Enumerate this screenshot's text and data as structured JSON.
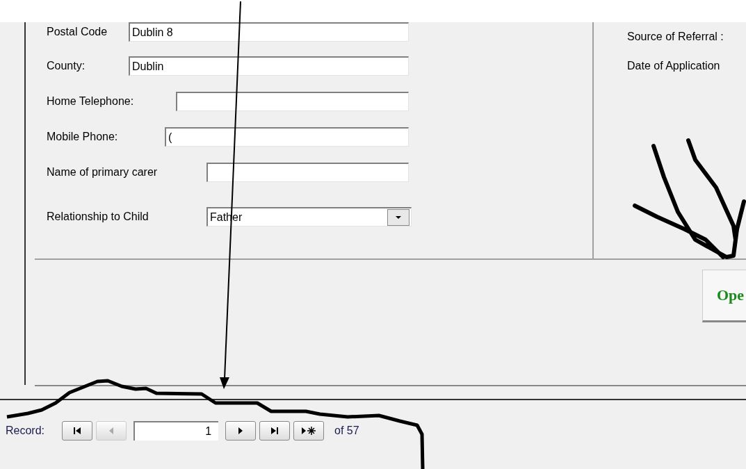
{
  "fields": [
    {
      "label": "Postal Code",
      "value": "Dublin 8",
      "kind": "text"
    },
    {
      "label": "County:",
      "value": "Dublin",
      "kind": "text"
    },
    {
      "label": "Home Telephone:",
      "kind": "text"
    },
    {
      "label": "Mobile Phone:",
      "value": "(",
      "kind": "text"
    },
    {
      "label": "Name of primary carer",
      "kind": "text"
    },
    {
      "label": "Relationship to Child",
      "value": "Father",
      "kind": "combo"
    }
  ],
  "right_labels": [
    "Source of Referral :",
    "Date of Application"
  ],
  "open_button": {
    "label": "Ope"
  },
  "record_nav": {
    "label": "Record:",
    "current": "1",
    "total": "of  57",
    "buttons": [
      {
        "kind": "first",
        "disabled": false
      },
      {
        "kind": "prev",
        "disabled": true
      },
      {
        "kind": "next",
        "disabled": false
      },
      {
        "kind": "last",
        "disabled": false
      },
      {
        "kind": "new",
        "disabled": false
      }
    ]
  }
}
